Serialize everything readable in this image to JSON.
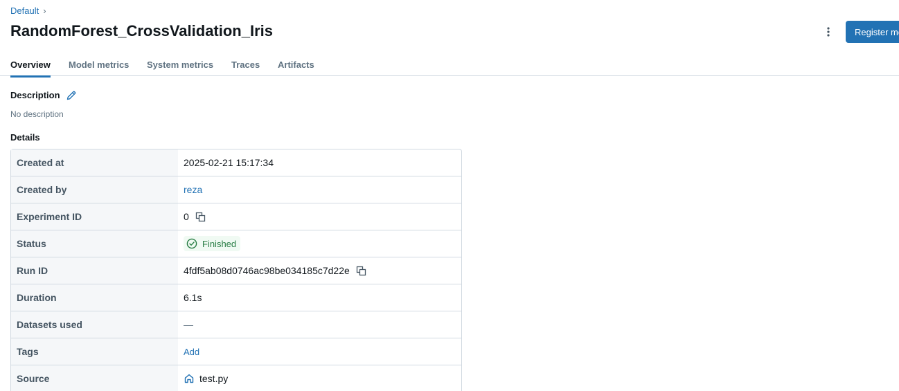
{
  "breadcrumb": {
    "parent": "Default",
    "separator": "›"
  },
  "title": "RandomForest_CrossValidation_Iris",
  "header": {
    "register_label": "Register model"
  },
  "tabs": [
    {
      "label": "Overview",
      "active": true
    },
    {
      "label": "Model metrics"
    },
    {
      "label": "System metrics"
    },
    {
      "label": "Traces"
    },
    {
      "label": "Artifacts"
    }
  ],
  "description": {
    "label": "Description",
    "empty_text": "No description"
  },
  "details": {
    "label": "Details",
    "rows": {
      "created_at": {
        "key": "Created at",
        "value": "2025-02-21 15:17:34"
      },
      "created_by": {
        "key": "Created by",
        "value": "reza"
      },
      "experiment_id": {
        "key": "Experiment ID",
        "value": "0"
      },
      "status": {
        "key": "Status",
        "value": "Finished"
      },
      "run_id": {
        "key": "Run ID",
        "value": "4fdf5ab08d0746ac98be034185c7d22e"
      },
      "duration": {
        "key": "Duration",
        "value": "6.1s"
      },
      "datasets_used": {
        "key": "Datasets used",
        "value": "—"
      },
      "tags": {
        "key": "Tags",
        "value": "Add"
      },
      "source": {
        "key": "Source",
        "value": "test.py"
      }
    }
  },
  "colors": {
    "accent": "#2272b4",
    "success": "#277c43",
    "success_bg": "#f0faf3",
    "border": "#d1d9e1",
    "muted_text": "#5f7281"
  },
  "icons": {
    "breadcrumb_separator": "chevron-right-icon",
    "menu": "kebab-menu-icon",
    "edit": "pencil-icon",
    "copy": "copy-icon",
    "status": "check-circle-icon",
    "source": "home-icon"
  }
}
